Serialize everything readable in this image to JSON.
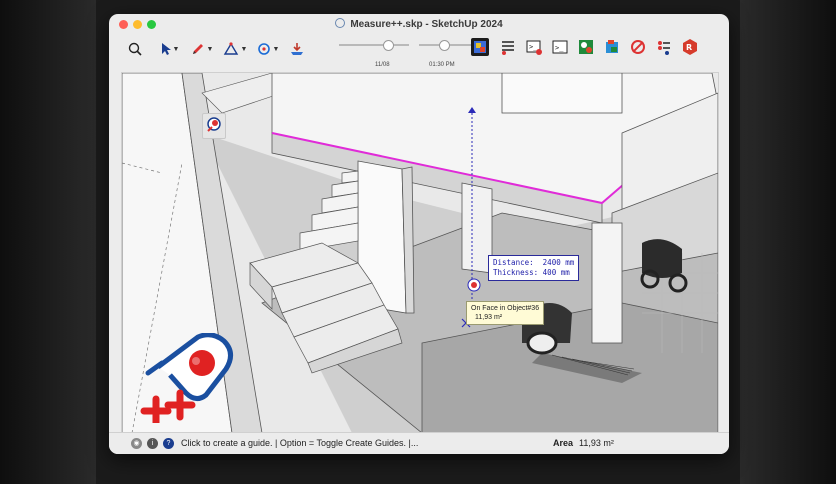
{
  "window": {
    "title": "Measure++.skp - SketchUp 2024"
  },
  "toolbar": {
    "tools": [
      {
        "icon": "search-icon"
      },
      {
        "icon": "select-arrow-icon"
      },
      {
        "icon": "pencil-icon"
      },
      {
        "icon": "shape-icon"
      },
      {
        "icon": "orbit-icon"
      },
      {
        "icon": "download-icon"
      }
    ],
    "sun_time_date": "11/08",
    "sun_time_time": "01:30 PM"
  },
  "viewport": {
    "measurement": "Distance:  2400 mm\nThickness: 400 mm",
    "inference_tip_line1": "On Face in Object#36",
    "inference_tip_line2": "11,93 m²",
    "guide_color": "#2a2ab8",
    "highlight_color": "#e02bd8"
  },
  "statusbar": {
    "hint": "Click to create a guide. | Option = Toggle Create Guides. |...",
    "measure_label": "Area",
    "measure_value": "11,93 m²"
  }
}
